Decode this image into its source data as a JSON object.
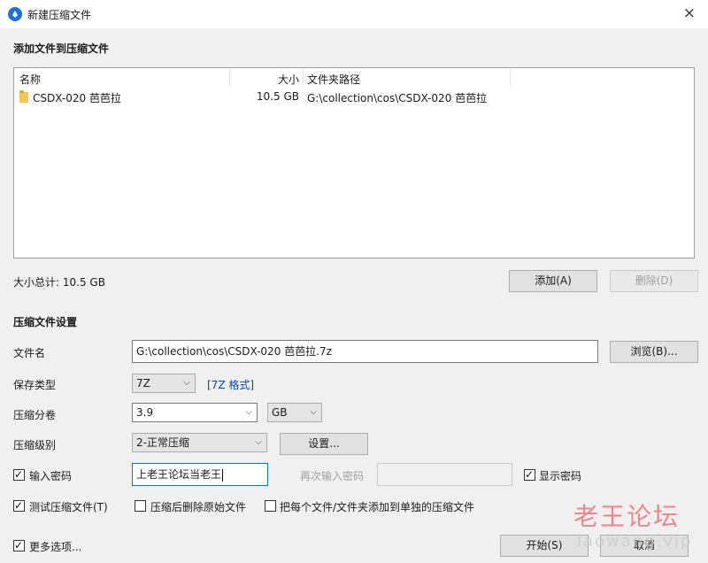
{
  "window": {
    "title": "新建压缩文件",
    "close_glyph": "×"
  },
  "add_section": {
    "title": "添加文件到压缩文件",
    "columns": {
      "name": "名称",
      "size": "大小",
      "path": "文件夹路径"
    },
    "rows": [
      {
        "name": "CSDX-020 芭芭拉",
        "size": "10.5 GB",
        "path": "G:\\collection\\cos\\CSDX-020 芭芭拉",
        "icon": "folder-icon"
      }
    ],
    "total_size": "大小总计: 10.5 GB",
    "add_label": "添加(A)",
    "delete_label": "删除(D)"
  },
  "settings": {
    "title": "压缩文件设置",
    "filename_label": "文件名",
    "filename_value": "G:\\collection\\cos\\CSDX-020 芭芭拉.7z",
    "browse_label": "浏览(B)...",
    "type_label": "保存类型",
    "type_value": "7Z",
    "type_link": "[7Z 格式]",
    "volume_label": "压缩分卷",
    "volume_value": "3.9",
    "volume_unit": "GB",
    "level_label": "压缩级别",
    "level_value": "2-正常压缩",
    "settings_button": "设置...",
    "password_check_label": "输入密码",
    "password_checked": true,
    "password_value": "上老王论坛当老王",
    "repeat_password_label": "再次输入密码",
    "repeat_password_value": "",
    "show_password_label": "显示密码",
    "show_password_checked": true,
    "test_label": "测试压缩文件(T)",
    "test_checked": true,
    "delete_after_label": "压缩后删除原始文件",
    "delete_after_checked": false,
    "separate_label": "把每个文件/文件夹添加到单独的压缩文件",
    "separate_checked": false
  },
  "footer": {
    "more_options_label": "更多选项...",
    "more_options_checked": true,
    "start_label": "开始(S)",
    "cancel_label": "取消"
  },
  "watermark": {
    "text": "老王论坛",
    "sub": "laowang.vip"
  },
  "colors": {
    "accent": "#0078d7",
    "link": "#0645ad",
    "panel": "#f0f0f0"
  }
}
